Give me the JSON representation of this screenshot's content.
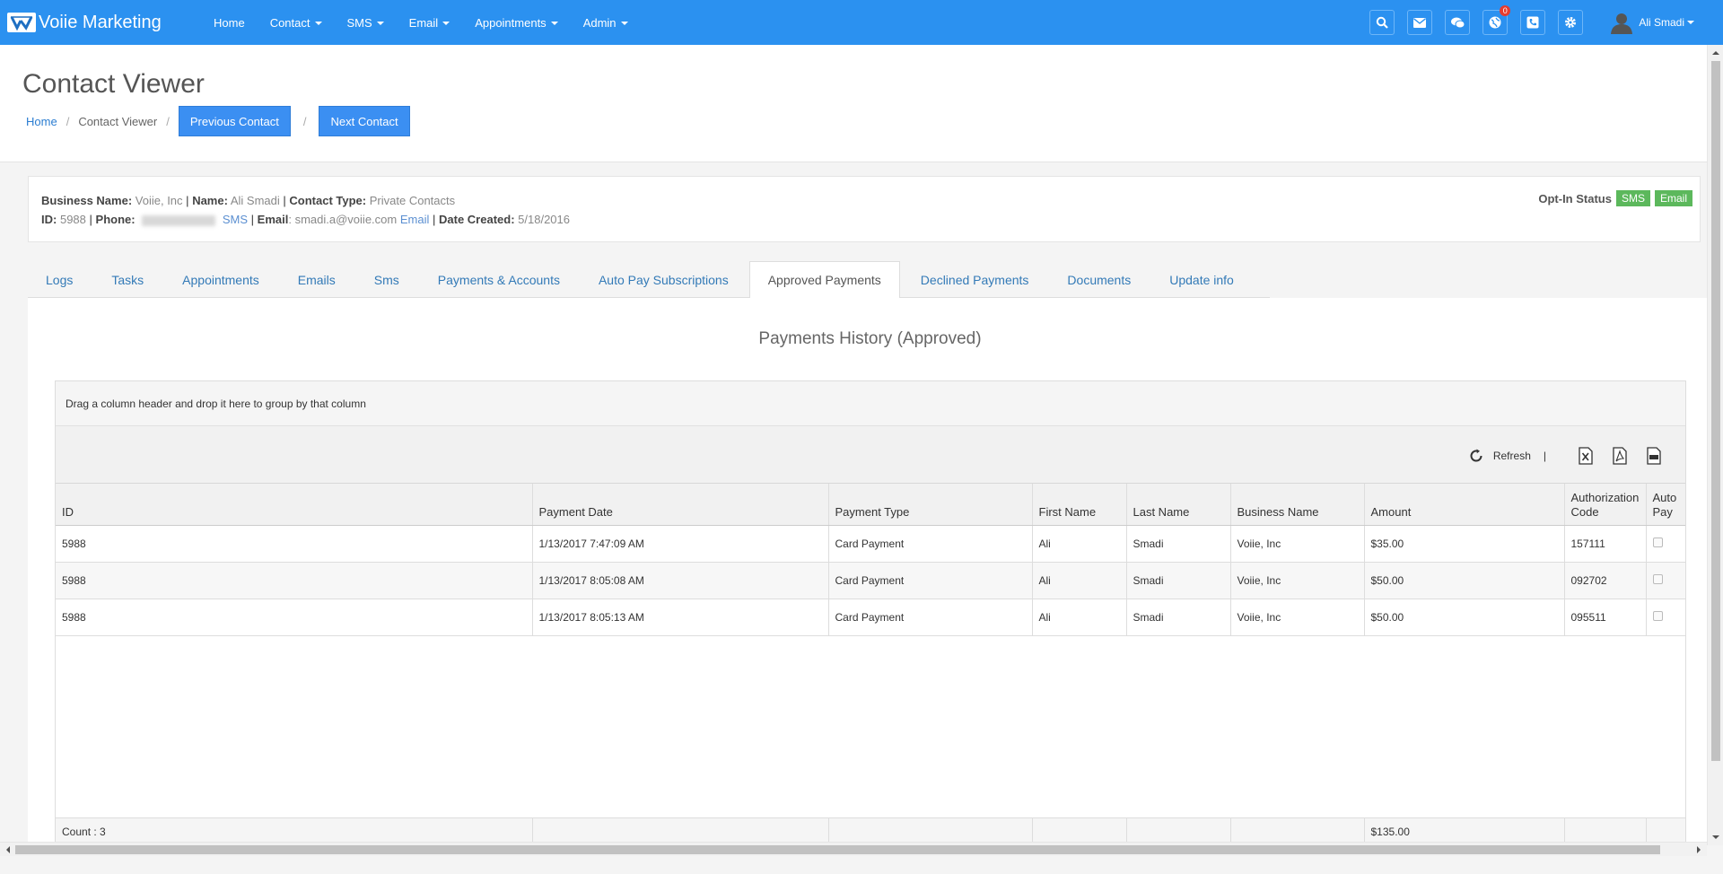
{
  "app": {
    "brand": "Voiie Marketing"
  },
  "nav": {
    "items": [
      {
        "label": "Home",
        "has_caret": false
      },
      {
        "label": "Contact",
        "has_caret": true
      },
      {
        "label": "SMS",
        "has_caret": true
      },
      {
        "label": "Email",
        "has_caret": true
      },
      {
        "label": "Appointments",
        "has_caret": true
      },
      {
        "label": "Admin",
        "has_caret": true
      }
    ],
    "icons": [
      "search-icon",
      "envelope-icon",
      "chat-icon",
      "globe-icon",
      "phone-icon",
      "gear-icon"
    ],
    "notification_count": "0",
    "user_name": "Ali Smadi"
  },
  "header": {
    "title": "Contact Viewer",
    "breadcrumb_home": "Home",
    "breadcrumb_current": "Contact Viewer",
    "sep": "/",
    "prev_button": "Previous Contact",
    "next_button": "Next Contact"
  },
  "contact": {
    "business_name_label": "Business Name:",
    "business_name": "Voiie, Inc",
    "name_label": "Name:",
    "name": "Ali Smadi",
    "contact_type_label": "Contact Type:",
    "contact_type": "Private Contacts",
    "id_label": "ID:",
    "id": "5988",
    "phone_label": "Phone:",
    "phone_sms_link": "SMS",
    "email_label": "Email",
    "email": "smadi.a@voiie.com",
    "email_link": "Email",
    "date_created_label": "Date Created:",
    "date_created": "5/18/2016",
    "pipe": "|",
    "optin_label": "Opt-In Status",
    "optin_sms": "SMS",
    "optin_email": "Email"
  },
  "tabs": [
    {
      "label": "Logs",
      "active": false
    },
    {
      "label": "Tasks",
      "active": false
    },
    {
      "label": "Appointments",
      "active": false
    },
    {
      "label": "Emails",
      "active": false
    },
    {
      "label": "Sms",
      "active": false
    },
    {
      "label": "Payments & Accounts",
      "active": false
    },
    {
      "label": "Auto Pay Subscriptions",
      "active": false
    },
    {
      "label": "Approved Payments",
      "active": true
    },
    {
      "label": "Declined Payments",
      "active": false
    },
    {
      "label": "Documents",
      "active": false
    },
    {
      "label": "Update info",
      "active": false
    }
  ],
  "payments": {
    "title": "Payments History (Approved)",
    "group_hint": "Drag a column header and drop it here to group by that column",
    "refresh_label": "Refresh",
    "toolbar_sep": "|",
    "export_icons": [
      "excel-export-icon",
      "pdf-export-icon",
      "csv-export-icon"
    ],
    "columns": [
      "ID",
      "Payment Date",
      "Payment Type",
      "First Name",
      "Last Name",
      "Business Name",
      "Amount",
      "Authorization Code",
      "Auto Pay"
    ],
    "rows": [
      {
        "id": "5988",
        "date": "1/13/2017 7:47:09 AM",
        "type": "Card Payment",
        "first": "Ali",
        "last": "Smadi",
        "business": "Voiie, Inc",
        "amount": "$35.00",
        "auth": "157111",
        "auto_pay": false
      },
      {
        "id": "5988",
        "date": "1/13/2017 8:05:08 AM",
        "type": "Card Payment",
        "first": "Ali",
        "last": "Smadi",
        "business": "Voiie, Inc",
        "amount": "$50.00",
        "auth": "092702",
        "auto_pay": false
      },
      {
        "id": "5988",
        "date": "1/13/2017 8:05:13 AM",
        "type": "Card Payment",
        "first": "Ali",
        "last": "Smadi",
        "business": "Voiie, Inc",
        "amount": "$50.00",
        "auth": "095511",
        "auto_pay": false
      }
    ],
    "footer_count": "Count : 3",
    "footer_total": "$135.00"
  },
  "colors": {
    "navbar": "#2b91f0",
    "button": "#3b8ff2",
    "optin_badge": "#5cb85c",
    "link": "#337ab7"
  }
}
